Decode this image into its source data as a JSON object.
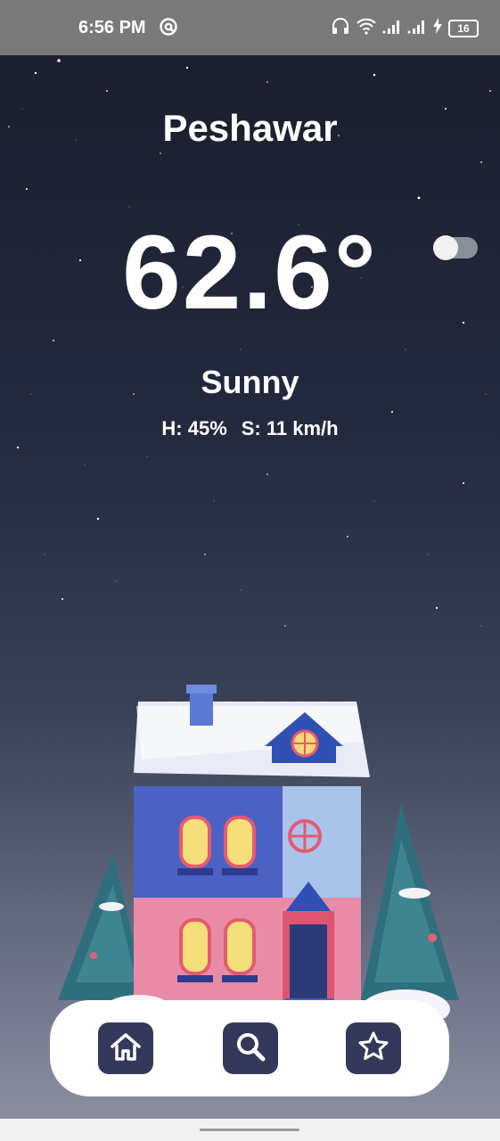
{
  "status_bar": {
    "time": "6:56 PM",
    "battery": "16"
  },
  "weather": {
    "city": "Peshawar",
    "temperature": "62.6°",
    "condition": "Sunny",
    "humidity": "H: 45%",
    "wind_speed": "S: 11 km/h",
    "unit_toggle_on": false
  },
  "nav": {
    "items": [
      {
        "icon": "home-icon"
      },
      {
        "icon": "search-icon"
      },
      {
        "icon": "star-icon"
      }
    ]
  },
  "colors": {
    "nav_button": "#34395b",
    "nav_bar": "#ffffff",
    "text": "#ffffff"
  }
}
